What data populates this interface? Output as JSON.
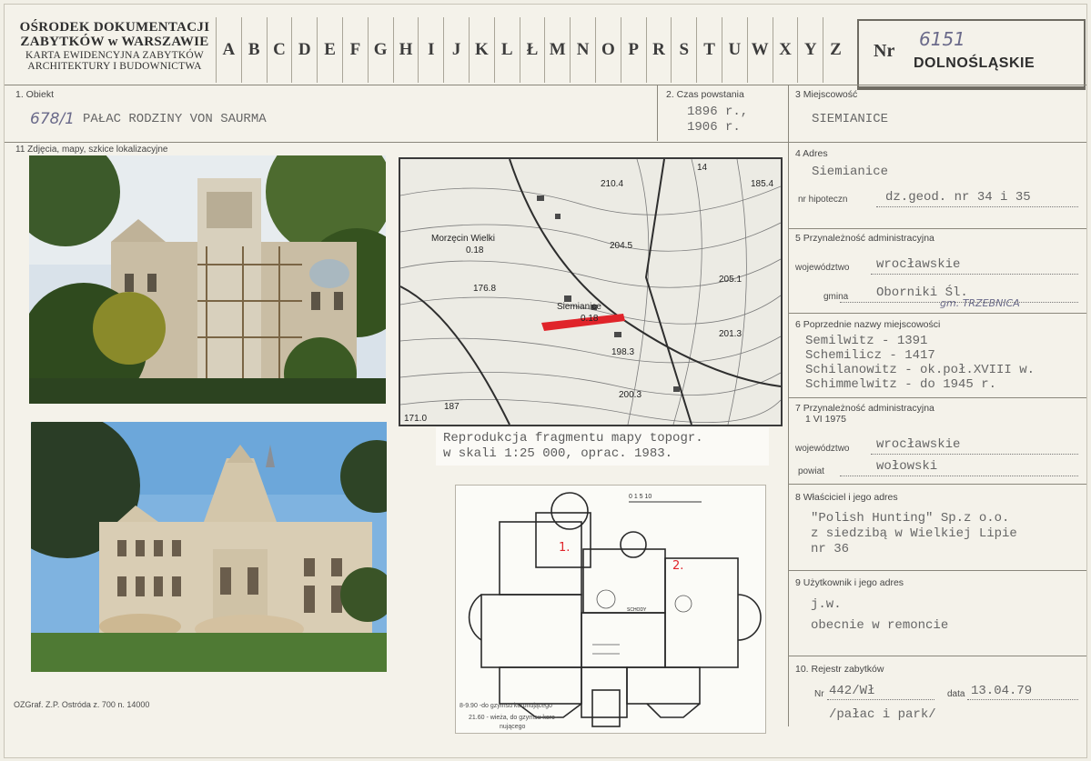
{
  "header": {
    "institution_line1": "OŚRODEK DOKUMENTACJI",
    "institution_line2": "ZABYTKÓW w WARSZAWIE",
    "institution_line3": "KARTA EWIDENCYJNA ZABYTKÓW",
    "institution_line4": "ARCHITEKTURY I BUDOWNICTWA",
    "alphabet": [
      "A",
      "B",
      "C",
      "D",
      "E",
      "F",
      "G",
      "H",
      "I",
      "J",
      "K",
      "L",
      "Ł",
      "M",
      "N",
      "O",
      "P",
      "R",
      "S",
      "T",
      "U",
      "W",
      "X",
      "Y",
      "Z"
    ],
    "nr_label": "Nr",
    "nr_value": "6151",
    "region": "DOLNOŚLĄSKIE"
  },
  "obiekt": {
    "label": "1. Obiekt",
    "handwritten": "678/1",
    "value": "PAŁAC RODZINY VON SAURMA"
  },
  "czas": {
    "label": "2. Czas powstania",
    "line1": "1896 r.,",
    "line2": "1906 r."
  },
  "miejscowosc": {
    "label": "3 Miejscowość",
    "value": "SIEMIANICE"
  },
  "zdjecia_label": "11 Zdjęcia, mapy, szkice lokalizacyjne",
  "adres": {
    "label": "4 Adres",
    "value": "Siemianice",
    "hip_label": "nr hipoteczn",
    "hip_value": "dz.geod. nr 34 i 35"
  },
  "przynaleznosc": {
    "label": "5 Przynależność administracyjna",
    "woj_label": "województwo",
    "woj_value": "wrocławskie",
    "gmina_label": "gmina",
    "gmina_value": "Oborniki Śl.",
    "gmina_note": "gm. TRZEBNICA"
  },
  "poprzednie": {
    "label": "6 Poprzednie nazwy miejscowości",
    "lines": [
      "Semilwitz - 1391",
      "Schemilicz - 1417",
      "Schilanowitz - ok.poł.XVIII w.",
      "Schimmelwitz - do 1945 r."
    ]
  },
  "przynaleznosc1975": {
    "label": "7 Przynależność administracyjna",
    "date": "1 VI 1975",
    "woj_label": "województwo",
    "woj_value": "wrocławskie",
    "powiat_label": "powiat",
    "powiat_value": "wołowski"
  },
  "wlasciciel": {
    "label": "8 Właściciel i jego adres",
    "lines": [
      "\"Polish Hunting\" Sp.z o.o.",
      "z siedzibą w Wielkiej Lipie",
      "nr 36"
    ]
  },
  "uzytkownik": {
    "label": "9 Użytkownik i jego adres",
    "lines": [
      "j.w.",
      "obecnie w remoncie"
    ]
  },
  "rejestr": {
    "label": "10. Rejestr zabytków",
    "nr_label": "Nr",
    "nr_value": "442/Wł",
    "data_label": "data",
    "data_value": "13.04.79",
    "note": "/pałac i park/"
  },
  "map": {
    "labels": {
      "morzecin": "Morzęcin Wielki",
      "morzecin_code": "0.18",
      "siemianice": "Siemianice",
      "siemianice_code": "0.18",
      "h2104": "210.4",
      "h1854": "185.4",
      "h2051": "205.1",
      "h1768": "176.8",
      "h1983": "198.3",
      "h2003": "200.3",
      "h2045": "204.5",
      "h2013": "201.3",
      "h187": "187",
      "h1710": "171.0",
      "sheet": "14"
    }
  },
  "caption": {
    "line1": "Reprodukcja fragmentu mapy topogr.",
    "line2": "w skali 1:25 000, oprac. 1983."
  },
  "plan": {
    "room1": "1.",
    "room2": "2.",
    "schody": "SCHODY",
    "note1": "8-9.90 -do gzymsu koronującego",
    "note2": "21.60 - wieża, do gzymsu koro-",
    "note3": "nującego",
    "scale": "0  1      5          10"
  },
  "footer": "OZGraf. Z.P. Ostróda z. 700 n. 14000",
  "colors": {
    "accent_red": "#e0242a",
    "ink": "#2f2f2f"
  }
}
